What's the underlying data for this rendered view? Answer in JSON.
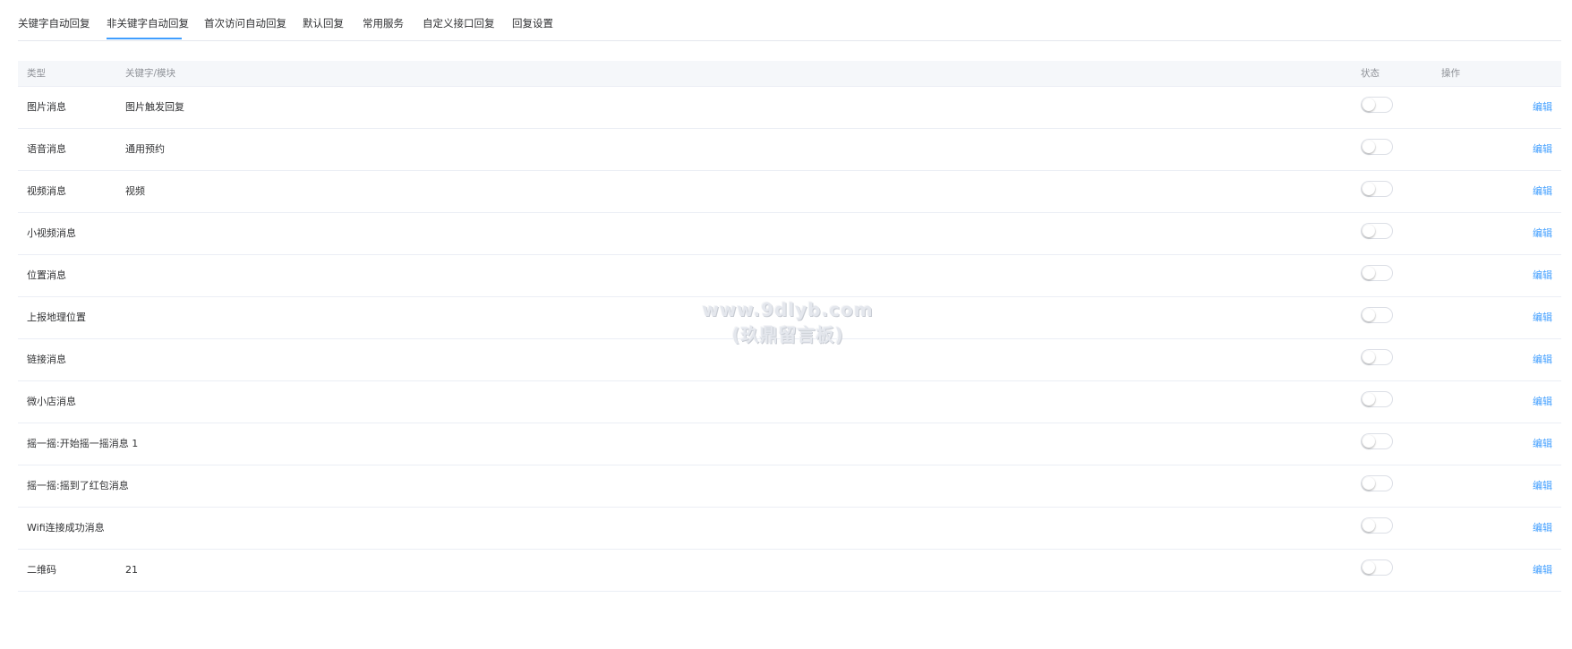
{
  "tabs": [
    {
      "label": "关键字自动回复"
    },
    {
      "label": "非关键字自动回复"
    },
    {
      "label": "首次访问自动回复"
    },
    {
      "label": "默认回复"
    },
    {
      "label": "常用服务"
    },
    {
      "label": "自定义接口回复"
    },
    {
      "label": "回复设置"
    }
  ],
  "active_tab": "非关键字自动回复",
  "table": {
    "headers": {
      "type": "类型",
      "keyword": "关键字/模块",
      "status": "状态",
      "operation": "操作"
    },
    "rows": [
      {
        "type": "图片消息",
        "keyword": "图片触发回复",
        "status": "off",
        "action": "编辑"
      },
      {
        "type": "语音消息",
        "keyword": "通用预约",
        "status": "off",
        "action": "编辑"
      },
      {
        "type": "视频消息",
        "keyword": "视频",
        "status": "off",
        "action": "编辑"
      },
      {
        "type": "小视频消息",
        "keyword": "",
        "status": "off",
        "action": "编辑"
      },
      {
        "type": "位置消息",
        "keyword": "",
        "status": "off",
        "action": "编辑"
      },
      {
        "type": "上报地理位置",
        "keyword": "",
        "status": "off",
        "action": "编辑"
      },
      {
        "type": "链接消息",
        "keyword": "",
        "status": "off",
        "action": "编辑"
      },
      {
        "type": "微小店消息",
        "keyword": "",
        "status": "off",
        "action": "编辑"
      },
      {
        "type": "摇一摇:开始摇一摇消息 1",
        "keyword": "",
        "status": "off",
        "action": "编辑"
      },
      {
        "type": "摇一摇:摇到了红包消息",
        "keyword": "",
        "status": "off",
        "action": "编辑"
      },
      {
        "type": "Wifi连接成功消息",
        "keyword": "",
        "status": "off",
        "action": "编辑"
      },
      {
        "type": "二维码",
        "keyword": "21",
        "status": "off",
        "action": "编辑"
      }
    ]
  },
  "watermark": {
    "line1": "www.9dlyb.com",
    "line2": "(玖鼎留言板)"
  },
  "colors": {
    "accent": "#409eff",
    "header_bg": "#f5f7fa",
    "border": "#ebeef5",
    "text": "#303133",
    "muted": "#909399"
  }
}
